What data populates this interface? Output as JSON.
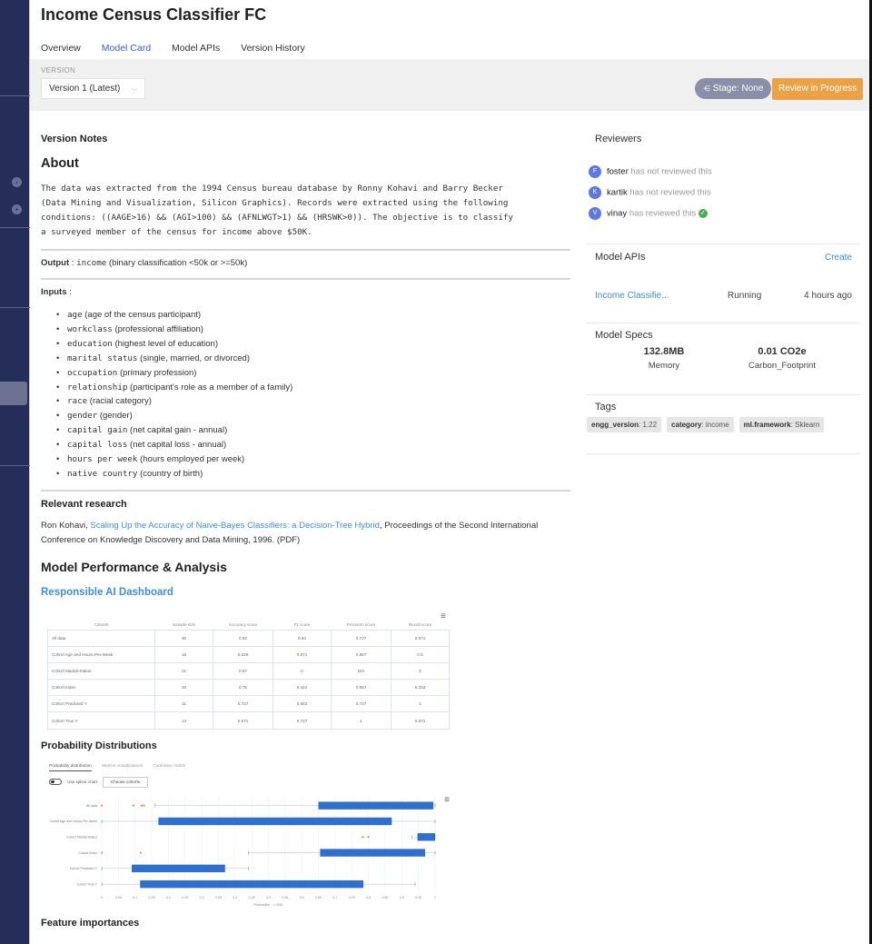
{
  "app": {
    "title": "Income Census Classifier FC",
    "tabs": [
      {
        "label": "Overview",
        "active": false
      },
      {
        "label": "Model Card",
        "active": true
      },
      {
        "label": "Model APIs",
        "active": false
      },
      {
        "label": "Version History",
        "active": false
      }
    ]
  },
  "version_bar": {
    "label": "VERSION",
    "selected": "Version 1 (Latest)",
    "stage_label": "Stage: None",
    "review_label": "Review in Progress",
    "review_color": "#eba247"
  },
  "version_notes": {
    "heading": "Version Notes",
    "about_heading": "About",
    "about_lines": [
      "The data was extracted from the 1994 Census bureau database by Ronny Kohavi and Barry Becker",
      "(Data Mining and Visualization, Silicon Graphics). Records were extracted using the following",
      "conditions: ((AAGE>16) && (AGI>100) && (AFNLWGT>1) && (HRSWK>0)). The objective is to classify",
      "a surveyed member of the census for income above $50K."
    ],
    "output_label": "Output",
    "output_code": "income",
    "output_desc": "(binary classification <50k or >=50k)",
    "inputs_label": "Inputs",
    "inputs": [
      {
        "code": "age",
        "desc": "(age of the census participant)"
      },
      {
        "code": "workclass",
        "desc": "(professional affiliation)"
      },
      {
        "code": "education",
        "desc": "(highest level of education)"
      },
      {
        "code": "marital status",
        "desc": "(single, married, or divorced)"
      },
      {
        "code": "occupation",
        "desc": "(primary profession)"
      },
      {
        "code": "relationship",
        "desc": "(participant's role as a member of a family)"
      },
      {
        "code": "race",
        "desc": "(racial category)"
      },
      {
        "code": "gender",
        "desc": "(gender)"
      },
      {
        "code": "capital gain",
        "desc": "(net capital gain - annual)"
      },
      {
        "code": "capital loss",
        "desc": "(net capital loss - annual)"
      },
      {
        "code": "hours per week",
        "desc": "(hours employed per week)"
      },
      {
        "code": "native country",
        "desc": "(country of birth)"
      }
    ],
    "research_heading": "Relevant research",
    "research_author": "Ron Kohavi, ",
    "research_link": "Scaling Up the Accuracy of Naive-Bayes Classifiers: a Decision-Tree Hybrid",
    "research_rest_1": ", Proceedings of the Second International",
    "research_rest_2": "Conference on Knowledge Discovery and Data Mining, 1996. (PDF)"
  },
  "performance": {
    "heading": "Model Performance & Analysis",
    "rai_link": "Responsible AI Dashboard",
    "cohort_table": {
      "columns": [
        "Cohorts",
        "Sample size",
        "Accuracy score",
        "F1 score",
        "Precision score",
        "Recall score"
      ],
      "rows": [
        [
          "All data",
          "30",
          "0.82",
          "0.64",
          "0.727",
          "0.571"
        ],
        [
          "Cohort Age and Hours-Per-Week",
          "16",
          "0.625",
          "0.571",
          "0.667",
          "0.5"
        ],
        [
          "Cohort Marital-Status",
          "21",
          "0.87",
          "0",
          "N/A",
          "0"
        ],
        [
          "Cohort Index",
          "20",
          "0.75",
          "0.444",
          "0.667",
          "0.333"
        ],
        [
          "Cohort Predicted Y",
          "11",
          "0.727",
          "0.842",
          "0.727",
          "1"
        ],
        [
          "Cohort True Y",
          "14",
          "0.571",
          "0.727",
          "1",
          "0.571"
        ]
      ]
    },
    "prob_heading": "Probability Distributions",
    "prob_tabs": [
      {
        "label": "Probability distribution",
        "active": true
      },
      {
        "label": "Metrics visualizations",
        "active": false
      },
      {
        "label": "Confusion matrix",
        "active": false
      }
    ],
    "spline_toggle_label": "Use spline chart",
    "spline_toggle_on": false,
    "choose_cohorts_label": "Choose cohorts",
    "feature_heading": "Feature importances"
  },
  "chart_data": {
    "type": "boxplot",
    "orientation": "horizontal",
    "xlabel": "Probability : <=50K",
    "xlim": [
      0,
      1
    ],
    "x_ticks": [
      "0",
      "0.05",
      "0.1",
      "0.15",
      "0.2",
      "0.25",
      "0.3",
      "0.35",
      "0.4",
      "0.45",
      "0.5",
      "0.55",
      "0.6",
      "0.65",
      "0.7",
      "0.75",
      "0.8",
      "0.85",
      "0.9",
      "0.95",
      "1"
    ],
    "grid": true,
    "box_color": "#2f6fcf",
    "outlier_color": "#f08a24",
    "series": [
      {
        "name": "All data",
        "whisker_low": 0.16,
        "q1": 0.65,
        "q3": 0.995,
        "whisker_high": 1.0,
        "outliers": [
          0.0,
          0.095,
          0.12,
          0.127
        ]
      },
      {
        "name": "Cohort Age and Hours-Per-Week",
        "whisker_low": 0.0,
        "q1": 0.17,
        "q3": 0.87,
        "whisker_high": 1.0,
        "outliers": []
      },
      {
        "name": "Cohort Marital-Status",
        "whisker_low": 0.93,
        "q1": 0.947,
        "q3": 1.0,
        "whisker_high": 1.0,
        "outliers": [
          0.783,
          0.8
        ]
      },
      {
        "name": "Cohort Index",
        "whisker_low": 0.44,
        "q1": 0.655,
        "q3": 0.97,
        "whisker_high": 1.0,
        "outliers": [
          0.0,
          0.117
        ]
      },
      {
        "name": "Cohort Predicted Y",
        "whisker_low": 0.0,
        "q1": 0.09,
        "q3": 0.37,
        "whisker_high": 0.44,
        "outliers": []
      },
      {
        "name": "Cohort True Y",
        "whisker_low": 0.0,
        "q1": 0.115,
        "q3": 0.785,
        "whisker_high": 0.94,
        "outliers": []
      }
    ]
  },
  "reviewers": {
    "heading": "Reviewers",
    "items": [
      {
        "initial": "F",
        "name": "foster",
        "status": "has not reviewed this",
        "reviewed": false
      },
      {
        "initial": "K",
        "name": "kartik",
        "status": "has not reviewed this",
        "reviewed": false
      },
      {
        "initial": "V",
        "name": "vinay",
        "status": "has reviewed this",
        "reviewed": true
      }
    ]
  },
  "model_apis": {
    "heading": "Model APIs",
    "create_label": "Create",
    "items": [
      {
        "name": "Income Classifie...",
        "status": "Running",
        "time": "4 hours ago"
      }
    ]
  },
  "model_specs": {
    "heading": "Model Specs",
    "items": [
      {
        "value": "132.8MB",
        "label": "Memory"
      },
      {
        "value": "0.01 CO2e",
        "label": "Carbon_Footprint"
      }
    ]
  },
  "tags": {
    "heading": "Tags",
    "items": [
      {
        "key": "engg_version",
        "value": "1.22"
      },
      {
        "key": "category",
        "value": "income"
      },
      {
        "key": "ml.framework",
        "value": "Sklearn"
      }
    ]
  },
  "icons": {
    "sidebar_expand": "chevron-right-circle-icon",
    "sidebar_add": "plus-circle-icon",
    "stage": "share-nodes-icon",
    "version_chevron": "chevron-down-icon",
    "table_menu": "hamburger-menu-icon",
    "chart_menu": "hamburger-menu-icon",
    "reviewed": "check-circle-icon"
  }
}
